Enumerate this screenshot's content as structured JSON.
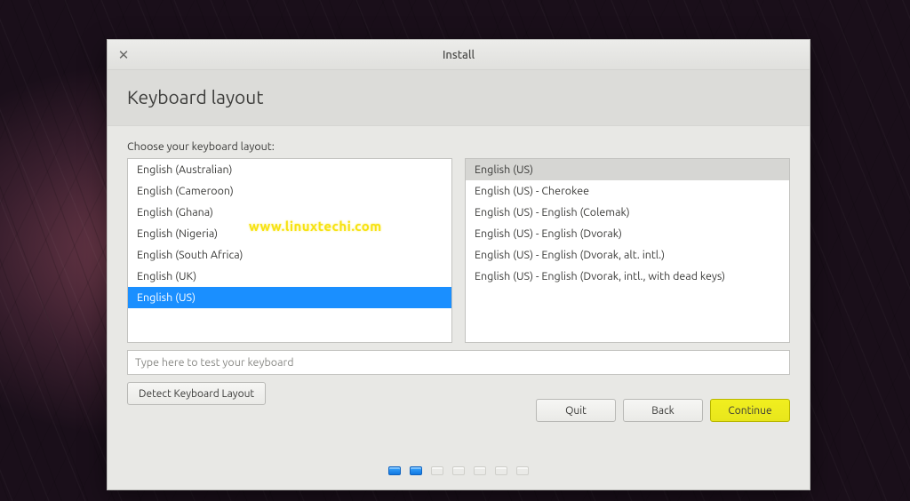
{
  "window": {
    "title": "Install",
    "heading": "Keyboard layout",
    "prompt": "Choose your keyboard layout:"
  },
  "left_list": {
    "items": [
      "English (Australian)",
      "English (Cameroon)",
      "English (Ghana)",
      "English (Nigeria)",
      "English (South Africa)",
      "English (UK)",
      "English (US)"
    ],
    "selected_index": 6
  },
  "right_list": {
    "items": [
      "English (US)",
      "English (US) - Cherokee",
      "English (US) - English (Colemak)",
      "English (US) - English (Dvorak)",
      "English (US) - English (Dvorak, alt. intl.)",
      "English (US) - English (Dvorak, intl., with dead keys)"
    ],
    "selected_index": 0
  },
  "test_input": {
    "placeholder": "Type here to test your keyboard",
    "value": ""
  },
  "buttons": {
    "detect": "Detect Keyboard Layout",
    "quit": "Quit",
    "back": "Back",
    "continue": "Continue"
  },
  "progress": {
    "total": 7,
    "current": 2
  },
  "watermark": "www.linuxtechi.com"
}
